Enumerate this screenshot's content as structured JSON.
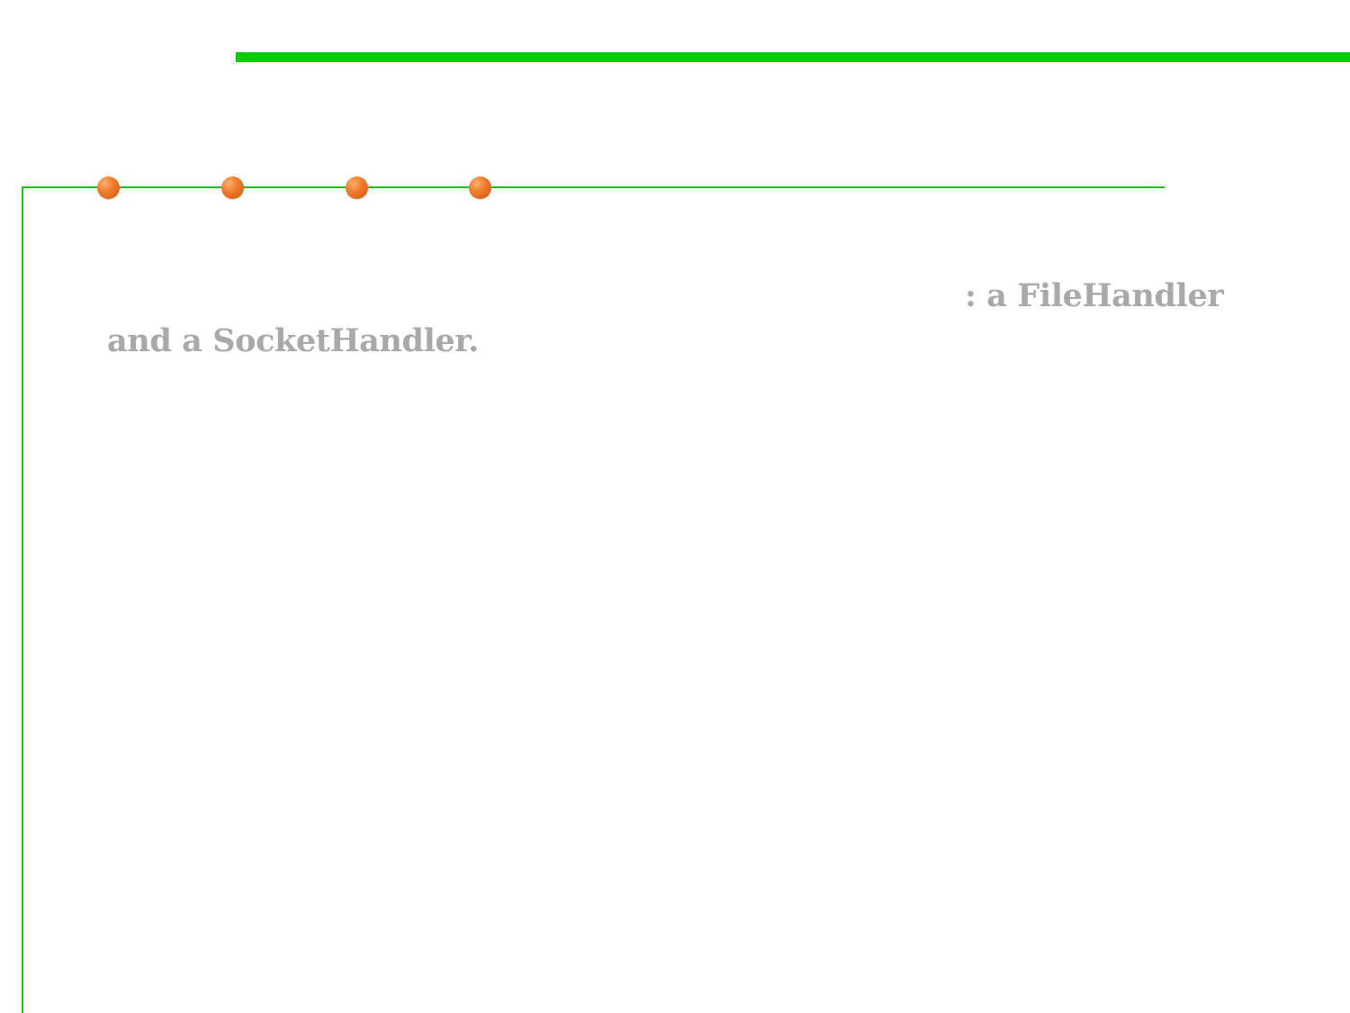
{
  "slide": {
    "accent_color": "#00cc00",
    "frame_line_color": "#1cc11c",
    "bullet_color": "#f07a2a",
    "text_color": "#a9a9a9",
    "text_lines": [
      ": a FileHandler",
      "and a SocketHandler."
    ],
    "bullet_icons": [
      "orange-sphere-icon",
      "orange-sphere-icon",
      "orange-sphere-icon",
      "orange-sphere-icon"
    ]
  }
}
